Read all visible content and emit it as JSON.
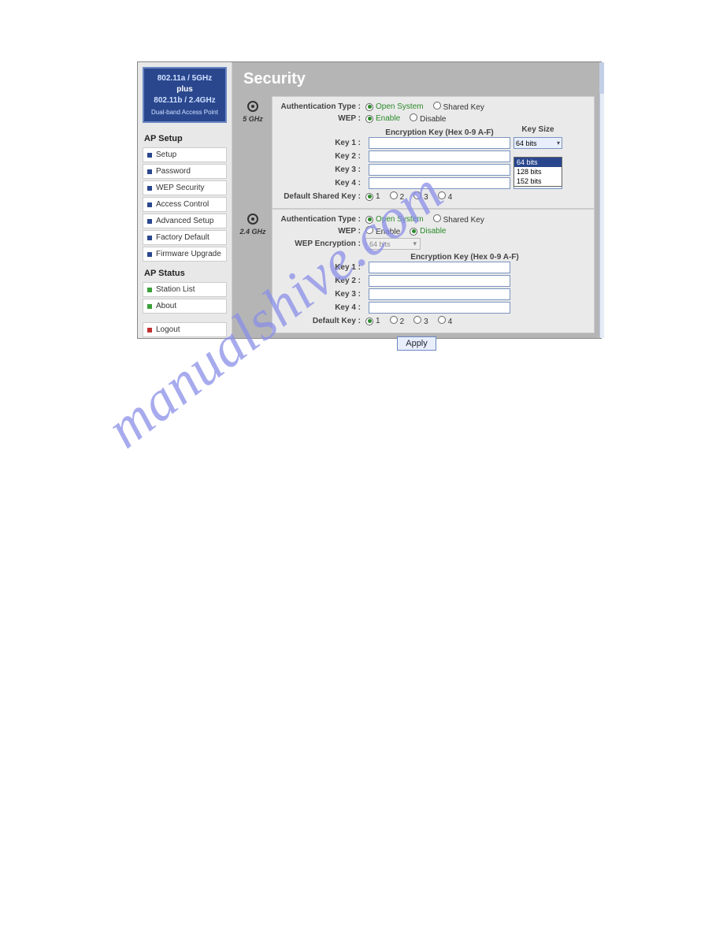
{
  "brand": {
    "line1": "802.11a / 5GHz",
    "line2": "plus",
    "line3": "802.11b / 2.4GHz",
    "line4": "Dual-band Access Point"
  },
  "nav": {
    "setup_heading": "AP Setup",
    "status_heading": "AP Status",
    "setup_items": [
      {
        "label": "Setup"
      },
      {
        "label": "Password"
      },
      {
        "label": "WEP Security"
      },
      {
        "label": "Access Control"
      },
      {
        "label": "Advanced Setup"
      },
      {
        "label": "Factory Default"
      },
      {
        "label": "Firmware Upgrade"
      }
    ],
    "status_items": [
      {
        "label": "Station List"
      },
      {
        "label": "About"
      }
    ],
    "logout": "Logout"
  },
  "page": {
    "title": "Security",
    "apply": "Apply"
  },
  "labels": {
    "auth_type": "Authentication Type :",
    "wep": "WEP :",
    "wep_encryption": "WEP Encryption :",
    "enc_key_header": "Encryption Key (Hex 0-9 A-F)",
    "key_size": "Key Size",
    "key1": "Key 1 :",
    "key2": "Key 2 :",
    "key3": "Key 3 :",
    "key4": "Key 4 :",
    "default_shared_key": "Default Shared Key :",
    "default_key": "Default Key :",
    "open_system": "Open System",
    "shared_key": "Shared Key",
    "enable": "Enable",
    "disable": "Disable",
    "band5": "5 GHz",
    "band24": "2.4 GHz"
  },
  "band5": {
    "auth": "open",
    "wep": "enable",
    "key1_size": "64 bits",
    "key4_size": "64 bits",
    "size_options": [
      "64 bits",
      "128 bits",
      "152 bits"
    ],
    "default_key_selected": "1"
  },
  "band24": {
    "auth": "open",
    "wep": "disable",
    "wep_enc": "64 bits",
    "default_key_selected": "1"
  },
  "watermark": "manualshive.com"
}
